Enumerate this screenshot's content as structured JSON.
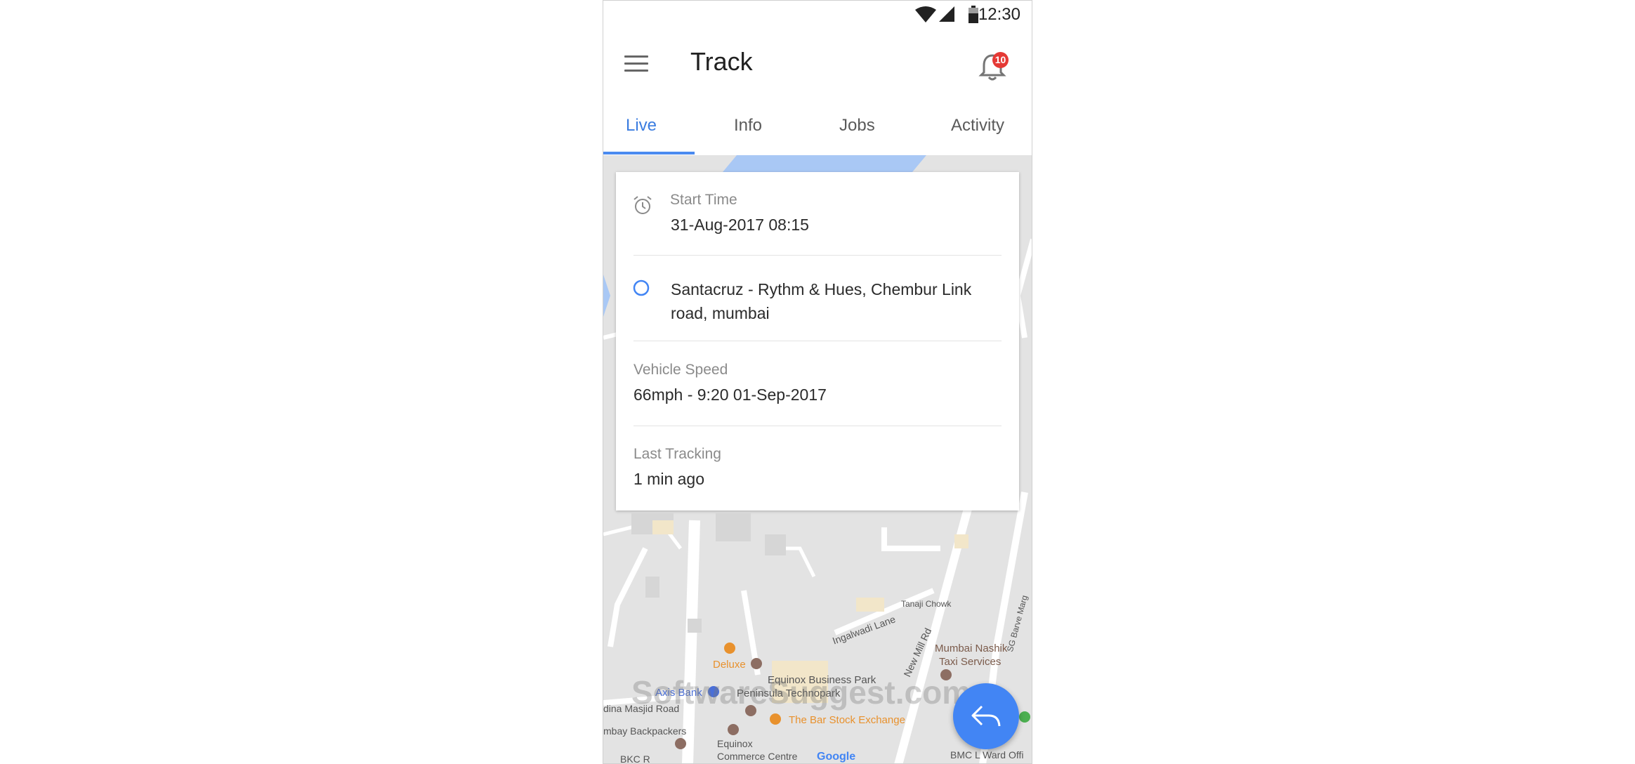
{
  "status_bar": {
    "time": "12:30"
  },
  "app_bar": {
    "title": "Track",
    "notification_count": "10"
  },
  "tabs": [
    {
      "label": "Live",
      "active": true
    },
    {
      "label": "Info",
      "active": false
    },
    {
      "label": "Jobs",
      "active": false
    },
    {
      "label": "Activity",
      "active": false
    }
  ],
  "card": {
    "start_time_label": "Start Time",
    "start_time_value": "31-Aug-2017 08:15",
    "location": "Santacruz - Rythm & Hues, Chembur Link road, mumbai",
    "vehicle_speed_label": "Vehicle Speed",
    "vehicle_speed_value": "66mph - 9:20 01-Sep-2017",
    "last_tracking_label": "Last Tracking",
    "last_tracking_value": "1 min ago"
  },
  "map": {
    "labels": {
      "tanaji_chowk": "Tanaji Chowk",
      "ingalwadi_lane": "Ingalwadi Lane",
      "new_mill_rd": "New Mill Rd",
      "mumbai_nashik_1": "Mumbai Nashik",
      "mumbai_nashik_2": "Taxi Services",
      "deluxe": "Deluxe",
      "equinox_bp": "Equinox Business Park",
      "peninsula": "Peninsula Technopark",
      "axis_bank": "Axis Bank",
      "masjid_road": "dina Masjid Road",
      "bar_stock": "The Bar Stock Exchange",
      "backpackers": "mbay Backpackers",
      "equinox_cc_1": "Equinox",
      "equinox_cc_2": "Commerce Centre",
      "bmc": "BMC L Ward Offi",
      "sg_barve": "SG Barve Marg",
      "bkc": "BKC R",
      "google": "Google",
      "watermark": "SoftwareSuggest.com"
    },
    "colors": {
      "background": "#e3e3e3",
      "road": "#ffffff",
      "water": "#a9c8f5",
      "poi_orange": "#e8912d",
      "poi_brown": "#8d6e63",
      "poi_blue": "#4a6fd8"
    }
  },
  "colors": {
    "accent": "#4285f4",
    "badge": "#e53935"
  },
  "icons": {
    "menu": "hamburger-menu-icon",
    "bell": "bell-icon",
    "alarm": "alarm-clock-icon",
    "location": "circle-location-icon",
    "fab": "reply-icon"
  }
}
